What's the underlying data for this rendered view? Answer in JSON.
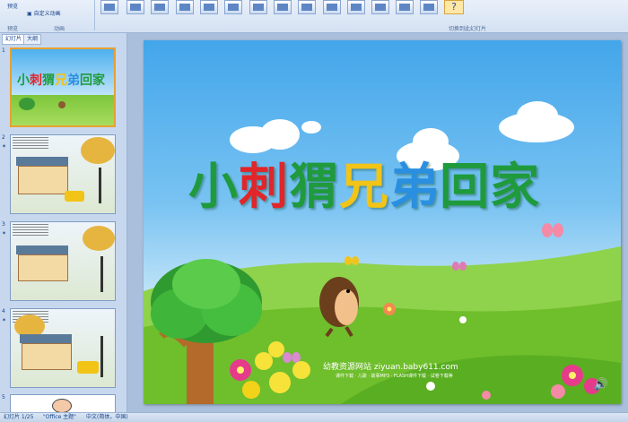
{
  "ribbon": {
    "btn_preview": "预览",
    "btn_custom_animation": "自定义动画",
    "group_preview": "预览",
    "group_animation": "动画",
    "group_transition": "切换到此幻灯片",
    "help_icon": "?"
  },
  "pane": {
    "tab_slides": "幻灯片",
    "tab_outline": "大纲",
    "slides": [
      {
        "num": "1"
      },
      {
        "num": "2"
      },
      {
        "num": "3"
      },
      {
        "num": "4"
      },
      {
        "num": "5"
      }
    ],
    "thumb1_title": "小刺猬兄弟回家"
  },
  "slide": {
    "title_chars": [
      "小",
      "刺",
      "猬",
      "兄",
      "弟",
      "回",
      "家"
    ],
    "title_colors": [
      "#1f9a3c",
      "#e0262a",
      "#1f9a3c",
      "#f2c417",
      "#2a8fe0",
      "#1f9a3c",
      "#1f9a3c"
    ],
    "footer_line1": "幼教资源网站  ziyuan.baby611.com",
    "footer_line2": "课件下载 · 儿歌 · 故事MP3 · FLASH课件下载 · 试卷下载等",
    "speaker_icon": "speaker-icon"
  },
  "status": {
    "slide_info": "幻灯片 1/25",
    "theme": "\"Office 主题\"",
    "language": "中文(简体，中国)"
  }
}
